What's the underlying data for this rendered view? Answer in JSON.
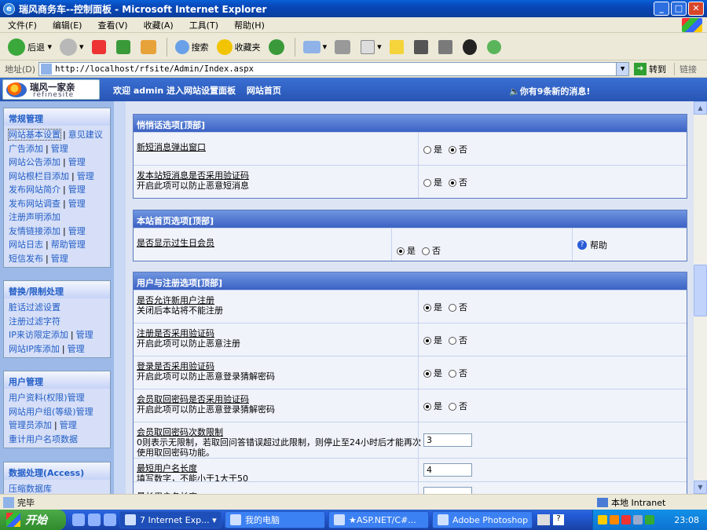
{
  "window": {
    "title": "瑞风商务车--控制面板 - Microsoft Internet Explorer"
  },
  "menu": [
    "文件(F)",
    "编辑(E)",
    "查看(V)",
    "收藏(A)",
    "工具(T)",
    "帮助(H)"
  ],
  "toolbar": {
    "back": "后退",
    "search": "搜索",
    "favorites": "收藏夹"
  },
  "address": {
    "label": "地址(D)",
    "url": "http://localhost/rfsite/Admin/Index.aspx",
    "go": "转到",
    "links": "链接"
  },
  "header": {
    "logo_title": "瑞风一家亲",
    "logo_sub": "refinesite",
    "welcome": "欢迎 admin 进入网站设置面板",
    "home": "网站首页",
    "messages": "你有9条新的消息!"
  },
  "sidebar": [
    {
      "title": "常规管理",
      "items": [
        [
          "网站基本设置",
          "意见建议"
        ],
        [
          "广告添加",
          "管理"
        ],
        [
          "网站公告添加",
          "管理"
        ],
        [
          "网站根栏目添加",
          "管理"
        ],
        [
          "发布网站简介",
          "管理"
        ],
        [
          "发布网站调查",
          "管理"
        ],
        [
          "注册声明添加"
        ],
        [
          "友情链接添加",
          "管理"
        ],
        [
          "网站日志",
          "帮助管理"
        ],
        [
          "短信发布",
          "管理"
        ]
      ]
    },
    {
      "title": "替换/限制处理",
      "items": [
        [
          "脏话过滤设置"
        ],
        [
          "注册过滤字符"
        ],
        [
          "IP来访限定添加",
          "管理"
        ],
        [
          "网站IP库添加",
          "管理"
        ]
      ]
    },
    {
      "title": "用户管理",
      "items": [
        [
          "用户资料(权限)管理"
        ],
        [
          "网站用户组(等级)管理"
        ],
        [
          "管理员添加",
          "管理"
        ],
        [
          "重计用户名项数据"
        ]
      ]
    },
    {
      "title": "数据处理(Access)",
      "items": [
        [
          "压缩数据库"
        ]
      ]
    }
  ],
  "sections": [
    {
      "title": "悄悄话选项[顶部]",
      "rows": [
        {
          "label": "新短消息弹出窗口",
          "desc": "",
          "type": "radio",
          "options": [
            "是",
            "否"
          ],
          "selected": 1
        },
        {
          "label": "发本站短消息是否采用验证码",
          "desc": "开启此项可以防止恶意短消息",
          "type": "radio",
          "options": [
            "是",
            "否"
          ],
          "selected": 1
        }
      ]
    },
    {
      "title": "本站首页选项[顶部]",
      "rows": [
        {
          "label": "是否显示过生日会员",
          "desc": "",
          "type": "radio",
          "options": [
            "是",
            "否"
          ],
          "selected": 0,
          "help": "帮助"
        }
      ]
    },
    {
      "title": "用户与注册选项[顶部]",
      "rows": [
        {
          "label": "是否允许新用户注册",
          "desc": "关闭后本站将不能注册",
          "type": "radio",
          "options": [
            "是",
            "否"
          ],
          "selected": 0
        },
        {
          "label": "注册是否采用验证码",
          "desc": "开启此项可以防止恶意注册",
          "type": "radio",
          "options": [
            "是",
            "否"
          ],
          "selected": 0
        },
        {
          "label": "登录是否采用验证码",
          "desc": "开启此项可以防止恶意登录猜解密码",
          "type": "radio",
          "options": [
            "是",
            "否"
          ],
          "selected": 0
        },
        {
          "label": "会员取回密码是否采用验证码",
          "desc": "开启此项可以防止恶意登录猜解密码",
          "type": "radio",
          "options": [
            "是",
            "否"
          ],
          "selected": 0
        },
        {
          "label": "会员取回密码次数限制",
          "desc": "0则表示无限制，若取回问答错误超过此限制，则停止至24小时后才能再次",
          "desc2": "使用取回密码功能。",
          "type": "input",
          "value": "3"
        },
        {
          "label": "最短用户名长度",
          "desc": "填写数字，不能小于1大于50",
          "type": "input",
          "value": "4"
        },
        {
          "label": "最长用户名长度",
          "desc": "",
          "type": "input",
          "value": ""
        }
      ]
    }
  ],
  "status": {
    "text": "完毕",
    "zone": "本地 Intranet"
  },
  "taskbar": {
    "start": "开始",
    "tasks": [
      "7 Internet Exp...",
      "我的电脑",
      "★ASP.NET/C#...",
      "Adobe Photoshop"
    ],
    "clock": "23:08"
  }
}
